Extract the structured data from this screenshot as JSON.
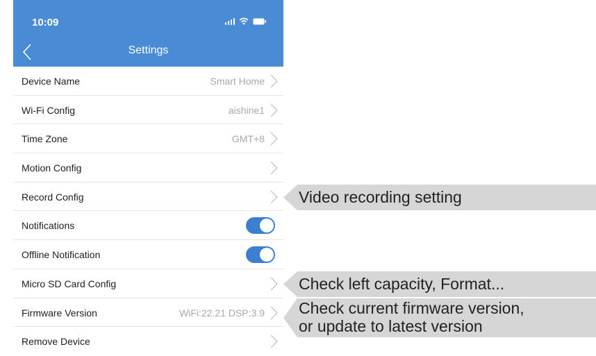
{
  "status_bar": {
    "time": "10:09"
  },
  "header": {
    "title": "Settings"
  },
  "rows": [
    {
      "label": "Device Name",
      "value": "Smart Home"
    },
    {
      "label": "Wi-Fi Config",
      "value": "aishine1"
    },
    {
      "label": "Time Zone",
      "value": "GMT+8"
    },
    {
      "label": "Motion Config",
      "value": ""
    },
    {
      "label": "Record Config",
      "value": ""
    },
    {
      "label": "Notifications",
      "toggle_on": true
    },
    {
      "label": "Offline Notification",
      "toggle_on": true
    },
    {
      "label": "Micro SD Card Config",
      "value": ""
    },
    {
      "label": "Firmware Version",
      "value": "WiFi:22.21 DSP:3.9"
    },
    {
      "label": "Remove Device",
      "value": ""
    }
  ],
  "callouts": {
    "record": "Video recording setting",
    "sdcard": "Check left capacity, Format...",
    "firmware_line1": "Check current firmware version,",
    "firmware_line2": "or update to latest version"
  },
  "colors": {
    "header_bg": "#4a8bd6",
    "toggle_on": "#3c7fd0",
    "callout_bg": "#d6d6d6"
  }
}
